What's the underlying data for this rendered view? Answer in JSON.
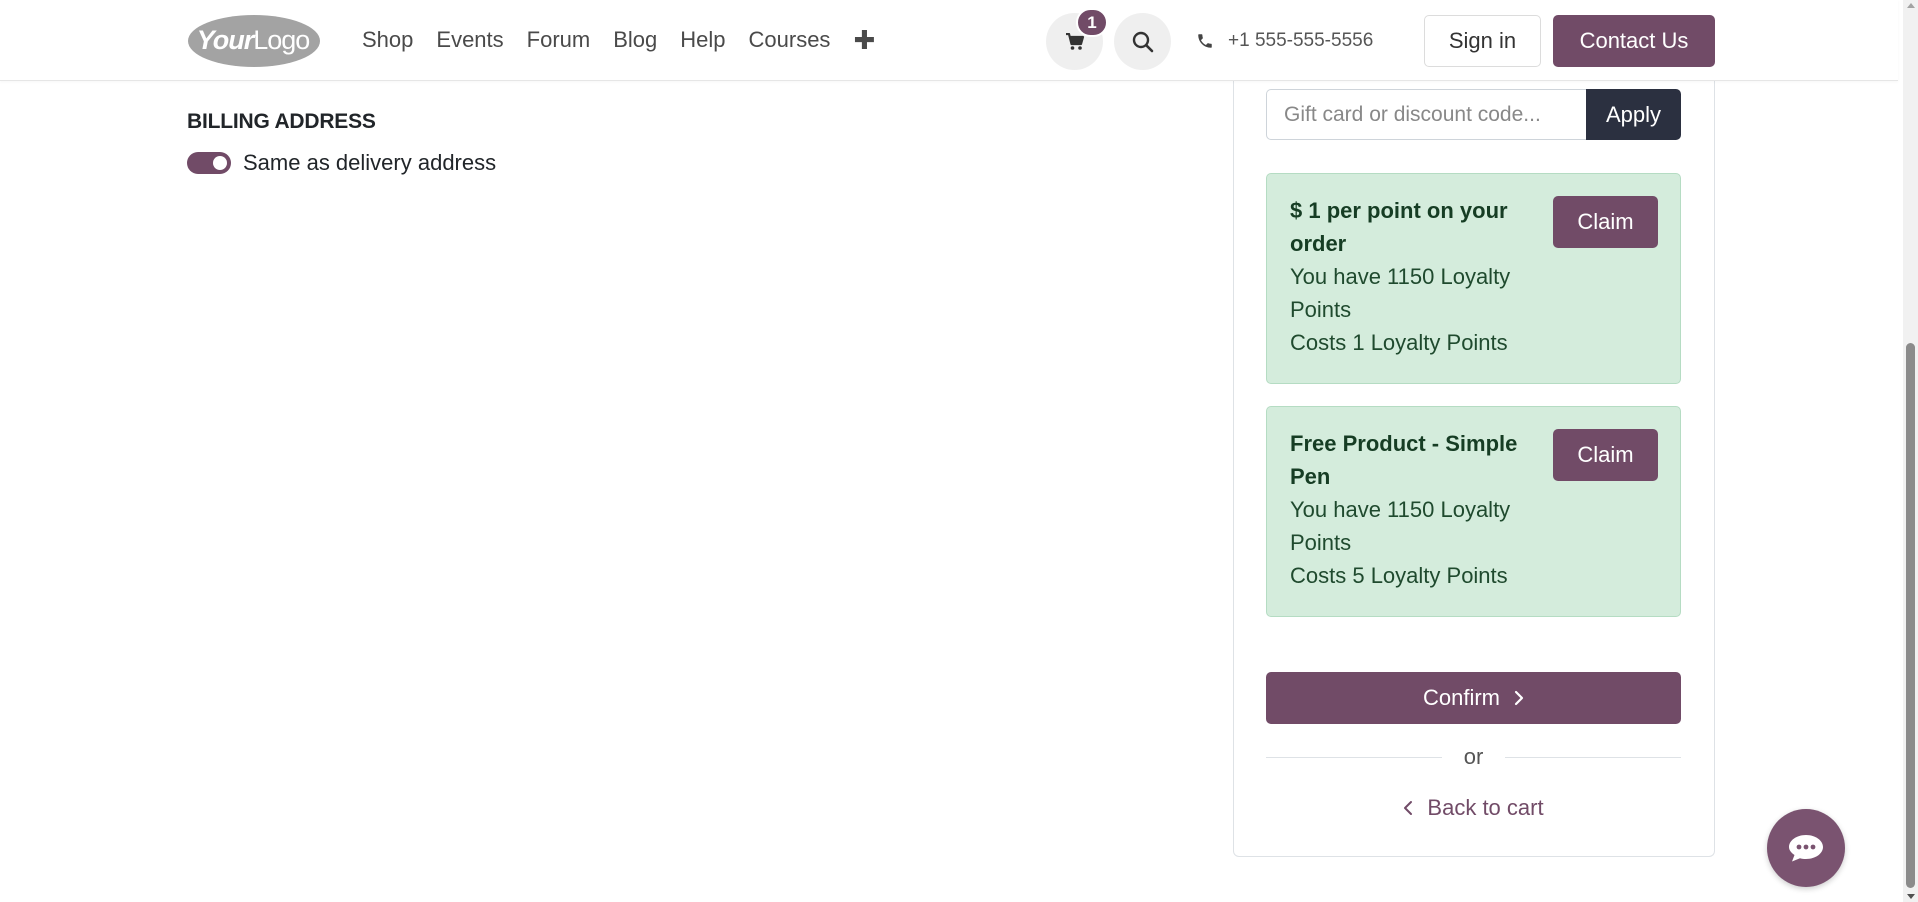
{
  "header": {
    "logo": {
      "bold": "Your",
      "regular": "Logo"
    },
    "nav": [
      "Shop",
      "Events",
      "Forum",
      "Blog",
      "Help",
      "Courses"
    ],
    "nav_plus": "✚",
    "cart_count": "1",
    "phone": "+1 555-555-5556",
    "sign_in": "Sign in",
    "contact": "Contact Us"
  },
  "billing": {
    "title": "BILLING ADDRESS",
    "same_as_delivery_label": "Same as delivery address",
    "same_as_delivery_checked": true
  },
  "summary": {
    "coupon_placeholder": "Gift card or discount code...",
    "apply_label": "Apply",
    "rewards": [
      {
        "title": "$ 1 per point on your order",
        "balance": "You have 1150 Loyalty Points",
        "cost": "Costs 1 Loyalty Points",
        "button": "Claim"
      },
      {
        "title": "Free Product - Simple Pen",
        "balance": "You have 1150 Loyalty Points",
        "cost": "Costs 5 Loyalty Points",
        "button": "Claim"
      }
    ],
    "confirm_label": "Confirm",
    "or_text": "or",
    "back_label": "Back to cart"
  },
  "colors": {
    "brand": "#714b67",
    "reward_bg": "#d4ecdc",
    "apply_bg": "#2b3040"
  },
  "icons": {
    "cart": "cart-icon",
    "search": "search-icon",
    "phone": "phone-icon",
    "chat": "chat-icon",
    "confirm_chevron": "chevron-right-icon",
    "back_chevron": "chevron-left-icon"
  }
}
